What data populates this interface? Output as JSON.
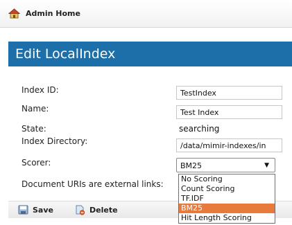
{
  "topbar": {
    "home_label": "Admin Home",
    "icon": "home-icon"
  },
  "page": {
    "title": "Edit LocalIndex"
  },
  "form": {
    "index_id_label": "Index ID:",
    "index_id_value": "TestIndex",
    "name_label": "Name:",
    "name_value": "Test Index",
    "state_label": "State:",
    "state_value": "searching",
    "directory_label": "Index Directory:",
    "directory_value": "/data/mimir-indexes/in",
    "scorer_label": "Scorer:",
    "scorer_selected": "BM25",
    "scorer_options": [
      "No Scoring",
      "Count Scoring",
      "TF.IDF",
      "BM25",
      "Hit Length Scoring"
    ],
    "external_links_label": "Document URIs are external links:"
  },
  "footer": {
    "save_label": "Save",
    "delete_label": "Delete"
  },
  "colors": {
    "title_band": "#1c6fa8",
    "selected_option": "#e87b3c"
  }
}
